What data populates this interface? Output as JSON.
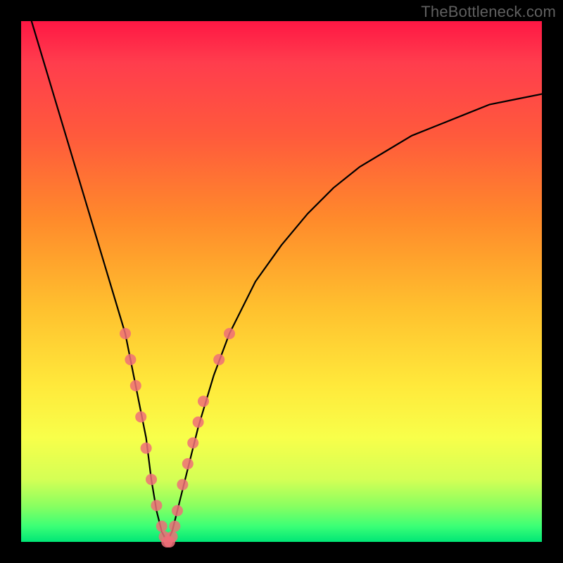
{
  "watermark": "TheBottleneck.com",
  "colors": {
    "background": "#000000",
    "curve": "#000000",
    "marker": "#ef6f78",
    "gradient_top": "#ff1744",
    "gradient_bottom": "#00e676"
  },
  "chart_data": {
    "type": "line",
    "title": "",
    "xlabel": "",
    "ylabel": "",
    "xlim": [
      0,
      100
    ],
    "ylim": [
      0,
      100
    ],
    "series": [
      {
        "name": "curve",
        "x": [
          2,
          5,
          8,
          11,
          14,
          17,
          20,
          22,
          24,
          25,
          26,
          27,
          28,
          29,
          30,
          32,
          34,
          37,
          40,
          45,
          50,
          55,
          60,
          65,
          70,
          75,
          80,
          85,
          90,
          95,
          100
        ],
        "values": [
          100,
          90,
          80,
          70,
          60,
          50,
          40,
          30,
          20,
          12,
          6,
          2,
          0,
          2,
          6,
          14,
          22,
          32,
          40,
          50,
          57,
          63,
          68,
          72,
          75,
          78,
          80,
          82,
          84,
          85,
          86
        ]
      }
    ],
    "markers": [
      {
        "x": 20,
        "y": 40
      },
      {
        "x": 21,
        "y": 35
      },
      {
        "x": 22,
        "y": 30
      },
      {
        "x": 23,
        "y": 24
      },
      {
        "x": 24,
        "y": 18
      },
      {
        "x": 25,
        "y": 12
      },
      {
        "x": 26,
        "y": 7
      },
      {
        "x": 27,
        "y": 3
      },
      {
        "x": 27.5,
        "y": 1
      },
      {
        "x": 28,
        "y": 0
      },
      {
        "x": 28.5,
        "y": 0
      },
      {
        "x": 29,
        "y": 1
      },
      {
        "x": 29.5,
        "y": 3
      },
      {
        "x": 30,
        "y": 6
      },
      {
        "x": 31,
        "y": 11
      },
      {
        "x": 32,
        "y": 15
      },
      {
        "x": 33,
        "y": 19
      },
      {
        "x": 34,
        "y": 23
      },
      {
        "x": 35,
        "y": 27
      },
      {
        "x": 38,
        "y": 35
      },
      {
        "x": 40,
        "y": 40
      }
    ]
  }
}
